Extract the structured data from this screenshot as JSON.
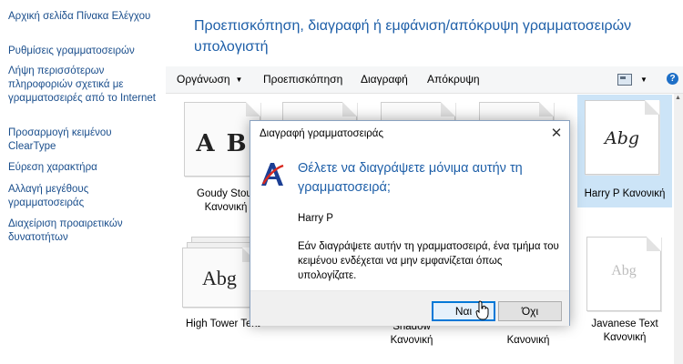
{
  "sidebar": {
    "items": [
      {
        "label": "Αρχική σελίδα Πίνακα Ελέγχου"
      },
      {
        "label": "Ρυθμίσεις γραμματοσειρών"
      },
      {
        "label": "Λήψη περισσότερων πληροφοριών σχετικά με γραμματοσειρές από το Internet"
      },
      {
        "label": "Προσαρμογή κειμένου ClearType"
      },
      {
        "label": "Εύρεση χαρακτήρα"
      },
      {
        "label": "Αλλαγή μεγέθους γραμματοσειράς"
      },
      {
        "label": "Διαχείριση προαιρετικών δυνατοτήτων"
      }
    ]
  },
  "main": {
    "title": "Προεπισκόπηση, διαγραφή ή εμφάνιση/απόκρυψη γραμματοσειρών υπολογιστή"
  },
  "toolbar": {
    "organize": "Οργάνωση",
    "preview": "Προεπισκόπηση",
    "delete": "Διαγραφή",
    "hide": "Απόκρυψη",
    "help": "?"
  },
  "tiles": [
    {
      "sample": "A B",
      "name": "Goudy Stout Κανονική"
    },
    {
      "sample": "Abg",
      "name": "Harry P Κανονική"
    },
    {
      "sample": "Abg",
      "name": "High Tower Text"
    },
    {
      "name": "Shadow Κανονική"
    },
    {
      "name": "Κανονική"
    },
    {
      "sample": "Abg",
      "name": "Javanese Text Κανονική"
    }
  ],
  "dialog": {
    "title": "Διαγραφή γραμματοσειράς",
    "heading": "Θέλετε να διαγράψετε μόνιμα αυτήν τη γραμματοσειρά;",
    "font_name": "Harry P",
    "message": "Εάν διαγράψετε αυτήν τη γραμματοσειρά, ένα τμήμα του κειμένου ενδέχεται να μην εμφανίζεται όπως υπολογίζατε.",
    "yes_label": "Ναι",
    "no_label": "Όχι"
  },
  "colors": {
    "link": "#1a4e8c",
    "heading": "#1e5fa8",
    "selection": "#cce4f7",
    "default_button_border": "#0078d7"
  }
}
